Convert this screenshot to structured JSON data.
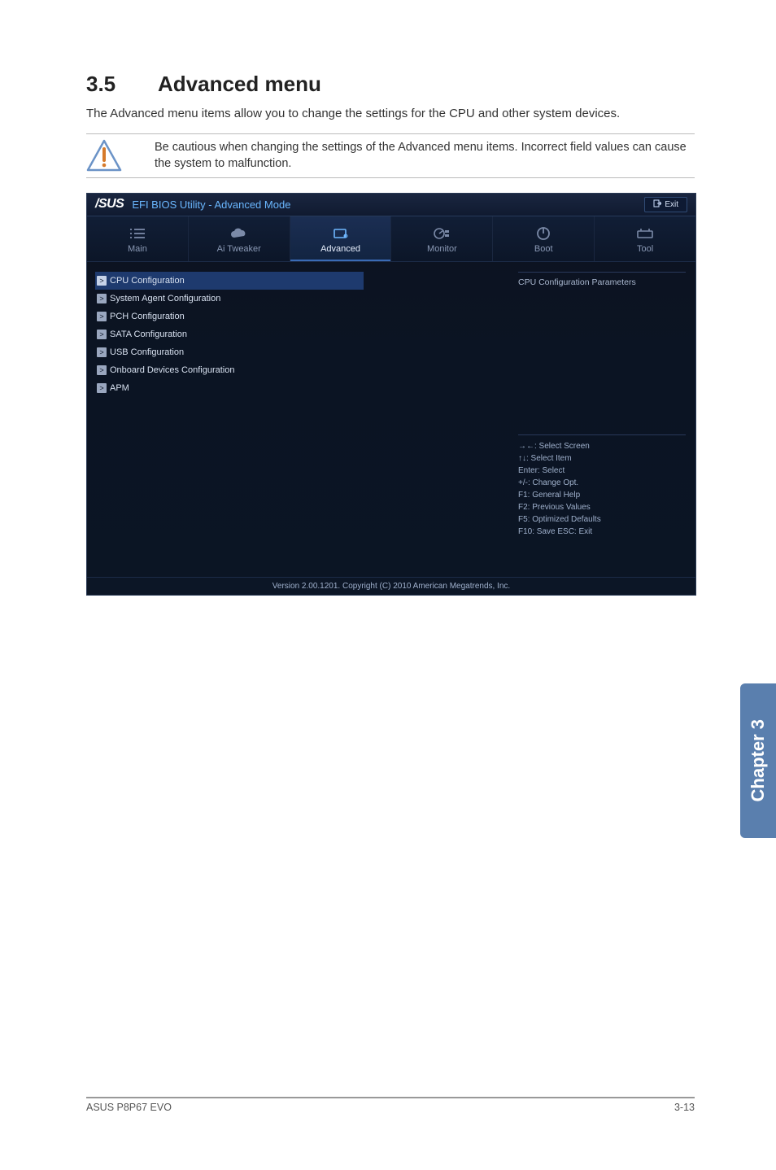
{
  "section": {
    "number": "3.5",
    "title": "Advanced menu"
  },
  "intro": "The Advanced menu items allow you to change the settings for the CPU and other system devices.",
  "note": "Be cautious when changing the settings of the Advanced menu items. Incorrect field values can cause the system to malfunction.",
  "bios": {
    "brand": "/SUS",
    "title": "EFI BIOS Utility - Advanced Mode",
    "exit_label": "Exit",
    "tabs": [
      {
        "label": "Main"
      },
      {
        "label": "Ai  Tweaker"
      },
      {
        "label": "Advanced"
      },
      {
        "label": "Monitor"
      },
      {
        "label": "Boot"
      },
      {
        "label": "Tool"
      }
    ],
    "menu": [
      {
        "label": "CPU Configuration",
        "selected": true
      },
      {
        "label": "System Agent Configuration"
      },
      {
        "label": "PCH Configuration"
      },
      {
        "label": "SATA Configuration"
      },
      {
        "label": "USB Configuration"
      },
      {
        "label": "Onboard Devices Configuration"
      },
      {
        "label": "APM"
      }
    ],
    "right_description": "CPU Configuration Parameters",
    "help": [
      "→←:  Select Screen",
      "↑↓:  Select Item",
      "Enter:  Select",
      "+/-:  Change Opt.",
      "F1:  General Help",
      "F2:  Previous Values",
      "F5:  Optimized Defaults",
      "F10:  Save   ESC:  Exit"
    ],
    "footer": "Version  2.00.1201.   Copyright  (C)  2010  American  Megatrends,  Inc."
  },
  "side_tab": "Chapter 3",
  "page_footer": {
    "left": "ASUS P8P67 EVO",
    "right": "3-13"
  }
}
